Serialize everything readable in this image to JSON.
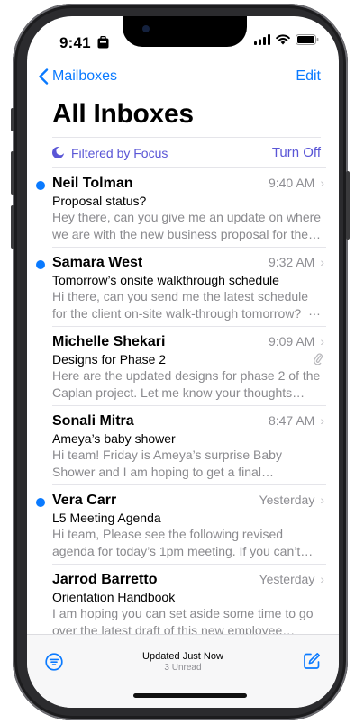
{
  "status_bar": {
    "time": "9:41"
  },
  "nav": {
    "back_label": "Mailboxes",
    "edit_label": "Edit"
  },
  "title": "All Inboxes",
  "focus": {
    "label": "Filtered by Focus",
    "action": "Turn Off"
  },
  "mails": [
    {
      "sender": "Neil Tolman",
      "time": "9:40 AM",
      "subject": "Proposal status?",
      "preview": "Hey there, can you give me an update on where we are with the new business proposal for the d...",
      "unread": true
    },
    {
      "sender": "Samara West",
      "time": "9:32 AM",
      "subject": "Tomorrow’s onsite walkthrough schedule",
      "preview": "Hi there, can you send me the latest schedule for the client on-site walk-through tomorrow?",
      "unread": true
    },
    {
      "sender": "Michelle Shekari",
      "time": "9:09 AM",
      "subject": "Designs for Phase 2",
      "preview": "Here are the updated designs for phase 2 of the Caplan project. Let me know your thoughts when...",
      "unread": false,
      "attachment": true
    },
    {
      "sender": "Sonali Mitra",
      "time": "8:47 AM",
      "subject": "Ameya’s baby shower",
      "preview": "Hi team! Friday is Ameya’s surprise Baby Shower and I am hoping to get a final headcount today s...",
      "unread": false
    },
    {
      "sender": "Vera Carr",
      "time": "Yesterday",
      "subject": "L5 Meeting Agenda",
      "preview": "Hi team, Please see the following revised agenda for today’s 1pm meeting. If you can’t attend in pe...",
      "unread": true
    },
    {
      "sender": "Jarrod Barretto",
      "time": "Yesterday",
      "subject": "Orientation Handbook",
      "preview": "I am hoping you can set aside some time to go over the latest draft of this new employee orient...",
      "unread": false
    }
  ],
  "toolbar": {
    "status": "Updated Just Now",
    "unread": "3 Unread"
  },
  "colors": {
    "accent": "#0a7aff",
    "focus": "#5a56d6",
    "secondary_text": "#8a8a8e"
  }
}
